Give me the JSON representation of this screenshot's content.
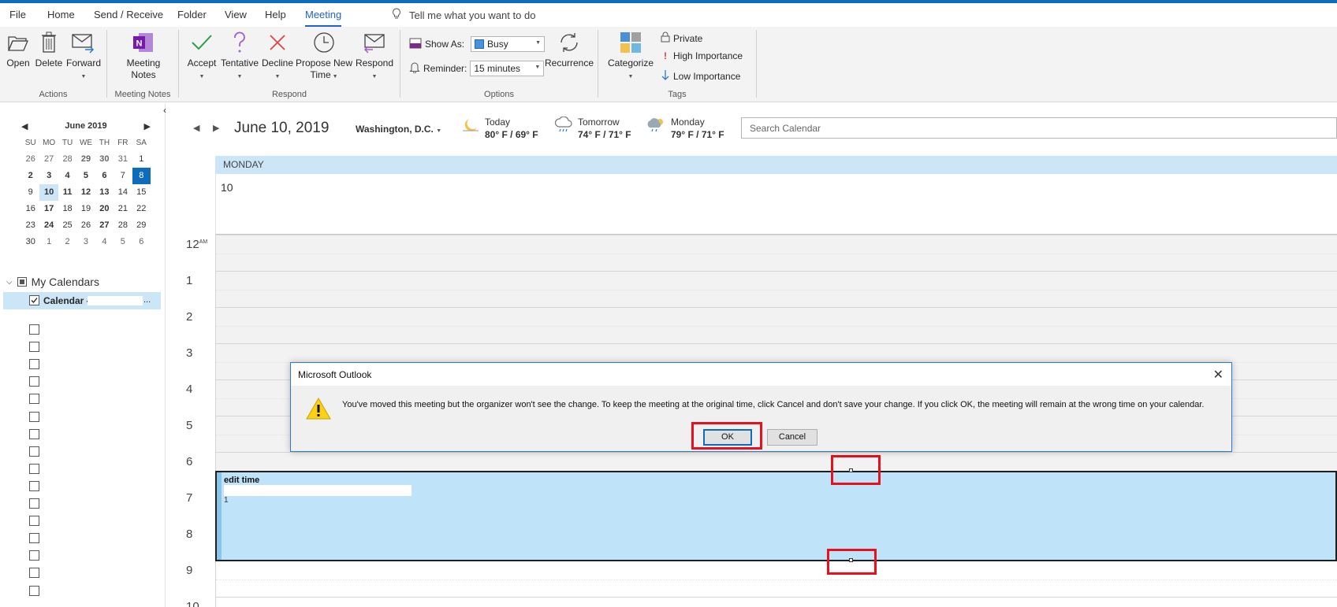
{
  "menu": {
    "tabs": [
      "File",
      "Home",
      "Send / Receive",
      "Folder",
      "View",
      "Help",
      "Meeting"
    ],
    "active_tab": "Meeting",
    "tellme": "Tell me what you want to do"
  },
  "ribbon": {
    "actions": {
      "open": "Open",
      "delete": "Delete",
      "forward": "Forward",
      "group": "Actions"
    },
    "meeting_notes": {
      "label1": "Meeting",
      "label2": "Notes",
      "group": "Meeting Notes"
    },
    "respond": {
      "accept": "Accept",
      "tentative": "Tentative",
      "decline": "Decline",
      "propose1": "Propose New",
      "propose2": "Time",
      "respond": "Respond",
      "group": "Respond"
    },
    "options": {
      "show_as_label": "Show As:",
      "show_as_value": "Busy",
      "reminder_label": "Reminder:",
      "reminder_value": "15 minutes",
      "recurrence": "Recurrence",
      "group": "Options"
    },
    "tags": {
      "categorize": "Categorize",
      "private": "Private",
      "high": "High Importance",
      "low": "Low Importance",
      "group": "Tags"
    }
  },
  "mini_calendar": {
    "month": "June 2019",
    "dow": [
      "SU",
      "MO",
      "TU",
      "WE",
      "TH",
      "FR",
      "SA"
    ],
    "weeks": [
      [
        "26",
        "27",
        "28",
        "29",
        "30",
        "31",
        "1"
      ],
      [
        "2",
        "3",
        "4",
        "5",
        "6",
        "7",
        "8"
      ],
      [
        "9",
        "10",
        "11",
        "12",
        "13",
        "14",
        "15"
      ],
      [
        "16",
        "17",
        "18",
        "19",
        "20",
        "21",
        "22"
      ],
      [
        "23",
        "24",
        "25",
        "26",
        "27",
        "28",
        "29"
      ],
      [
        "30",
        "1",
        "2",
        "3",
        "4",
        "5",
        "6"
      ]
    ]
  },
  "folders": {
    "group": "My Calendars",
    "calendar_label": "Calendar -",
    "ellipsis": "..."
  },
  "header": {
    "date": "June 10, 2019",
    "location": "Washington, D.C.",
    "weather": [
      {
        "day": "Today",
        "temp": "80° F / 69° F",
        "icon": "moon-icon"
      },
      {
        "day": "Tomorrow",
        "temp": "74° F / 71° F",
        "icon": "rain-icon"
      },
      {
        "day": "Monday",
        "temp": "79° F / 71° F",
        "icon": "thunderstorm-icon"
      }
    ],
    "search_placeholder": "Search Calendar"
  },
  "day_view": {
    "day_name": "MONDAY",
    "day_number": "10",
    "hours": [
      "12",
      "1",
      "2",
      "3",
      "4",
      "5",
      "6",
      "7",
      "8",
      "9",
      "10"
    ],
    "am_label": "AM"
  },
  "event": {
    "title": "edit time",
    "body": "1"
  },
  "dialog": {
    "title": "Microsoft Outlook",
    "message": "You've moved this meeting but the organizer won't see the change. To keep the meeting at the original time, click Cancel and don't save your change. If you click OK, the meeting will remain at the wrong time on your calendar.",
    "ok": "OK",
    "cancel": "Cancel"
  },
  "colors": {
    "accent": "#0f6cbd",
    "event_fill": "#bfe4fa",
    "highlight_red": "#e8101d"
  }
}
